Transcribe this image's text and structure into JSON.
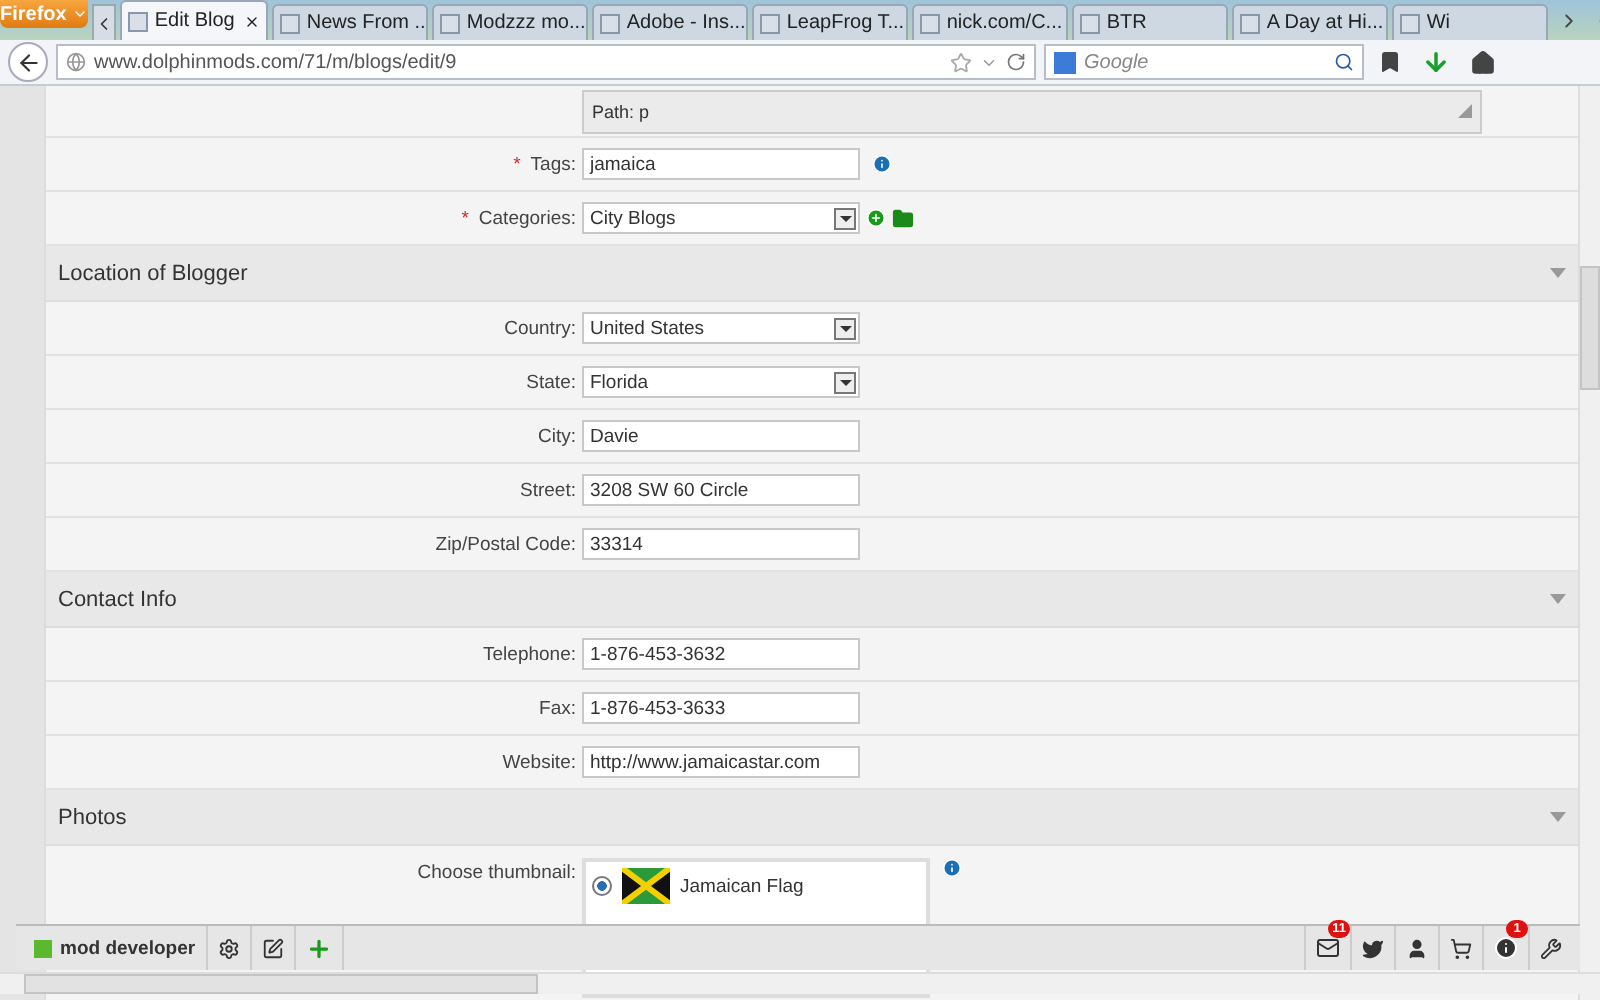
{
  "browser": {
    "menu_button": "Firefox",
    "tabs": [
      {
        "title": "Edit Blog",
        "selected": true
      },
      {
        "title": "News From ...",
        "selected": false
      },
      {
        "title": "Modzzz mo...",
        "selected": false
      },
      {
        "title": "Adobe - Ins...",
        "selected": false
      },
      {
        "title": "LeapFrog T...",
        "selected": false
      },
      {
        "title": "nick.com/C...",
        "selected": false
      },
      {
        "title": "BTR",
        "selected": false
      },
      {
        "title": "A Day at Hi...",
        "selected": false
      },
      {
        "title": "Wi",
        "selected": false
      }
    ],
    "url": "www.dolphinmods.com/71/m/blogs/edit/9",
    "search": {
      "placeholder": "Google"
    }
  },
  "form": {
    "path_text": "Path: p",
    "fields": [
      {
        "required_mark": "*",
        "label": "Tags:",
        "value": "jamaica",
        "kind": "text",
        "info": true
      },
      {
        "required_mark": "*",
        "label": "Categories:",
        "value": "City Blogs",
        "kind": "select-actions",
        "info": false
      }
    ],
    "sections": [
      {
        "title": "Location of Blogger",
        "fields": [
          {
            "label": "Country:",
            "value": "United States",
            "kind": "select",
            "info": false
          },
          {
            "label": "State:",
            "value": "Florida",
            "kind": "select",
            "info": false
          },
          {
            "label": "City:",
            "value": "Davie",
            "kind": "text",
            "info": false
          },
          {
            "label": "Street:",
            "value": "3208 SW 60 Circle",
            "kind": "text",
            "info": false
          },
          {
            "label": "Zip/Postal Code:",
            "value": "33314",
            "kind": "text",
            "info": false
          }
        ]
      },
      {
        "title": "Contact Info",
        "fields": [
          {
            "label": "Telephone:",
            "value": "1-876-453-3632",
            "kind": "text",
            "info": false
          },
          {
            "label": "Fax:",
            "value": "1-876-453-3633",
            "kind": "text",
            "info": false
          },
          {
            "label": "Website:",
            "value": "http://www.jamaicastar.com",
            "kind": "text",
            "info": false
          }
        ]
      },
      {
        "title": "Photos",
        "fields": [
          {
            "label": "Choose thumbnail:",
            "kind": "thumbnail",
            "info": true,
            "options": [
              {
                "name": "Jamaican Flag",
                "selected": true
              }
            ]
          }
        ]
      }
    ]
  },
  "toolbar": {
    "title": "mod developer",
    "mail_badge": "11",
    "info_badge": "1"
  }
}
